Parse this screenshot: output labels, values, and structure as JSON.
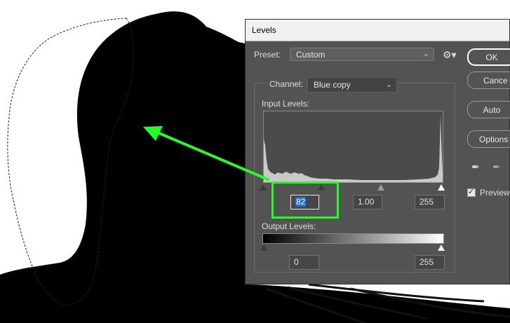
{
  "dialog": {
    "title": "Levels",
    "preset_label": "Preset:",
    "preset_value": "Custom",
    "channel_label": "Channel:",
    "channel_value": "Blue copy",
    "input_levels_label": "Input Levels:",
    "input_black": "82",
    "input_gamma": "1.00",
    "input_white": "255",
    "output_levels_label": "Output Levels:",
    "output_black": "0",
    "output_white": "255",
    "buttons": {
      "ok": "OK",
      "cancel": "Cance",
      "auto": "Auto",
      "options": "Options"
    },
    "preview_label": "Preview",
    "preview_checked": true
  },
  "colors": {
    "annotation": "#22ff22",
    "dialog_bg": "#535353",
    "selection": "#1f6fd4"
  }
}
